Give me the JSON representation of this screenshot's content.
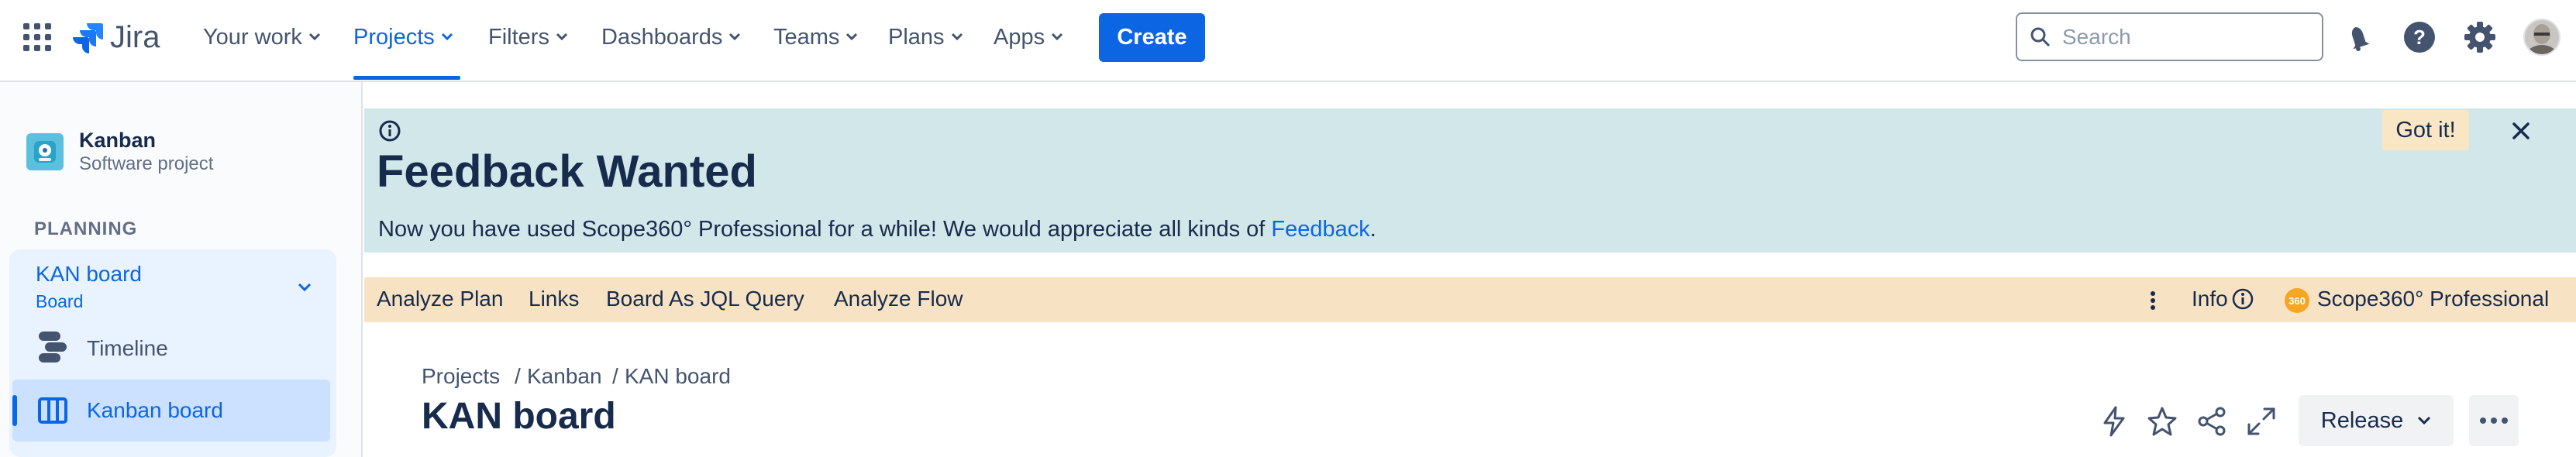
{
  "topnav": {
    "brand": "Jira",
    "items": [
      {
        "label": "Your work"
      },
      {
        "label": "Projects"
      },
      {
        "label": "Filters"
      },
      {
        "label": "Dashboards"
      },
      {
        "label": "Teams"
      },
      {
        "label": "Plans"
      },
      {
        "label": "Apps"
      }
    ],
    "create_label": "Create",
    "search_placeholder": "Search",
    "icons": [
      "app-switcher-icon",
      "notifications-icon",
      "help-icon",
      "settings-icon",
      "avatar"
    ],
    "accent_color": "#0c66e4"
  },
  "sidebar": {
    "project_name": "Kanban",
    "project_type": "Software project",
    "section_title": "PLANNING",
    "board_group_title": "KAN board",
    "board_group_subtitle": "Board",
    "items": [
      {
        "label": "Timeline",
        "icon": "timeline-icon"
      },
      {
        "label": "Kanban board",
        "icon": "board-icon",
        "selected": true
      }
    ]
  },
  "banner": {
    "title": "Feedback Wanted",
    "message": "Now you have used Scope360° Professional for a while! We would appreciate all kinds of ",
    "link": "Feedback",
    "message_end": ".",
    "got_it_label": "Got it!",
    "background": "#d2e7e9"
  },
  "scope_bar": {
    "items": [
      "Analyze Plan",
      "Links",
      "Board As JQL Query",
      "Analyze Flow"
    ],
    "info_label": "Info",
    "product_name": "Scope360° Professional",
    "product_badge": "360",
    "background": "#f8e2c4"
  },
  "header": {
    "breadcrumbs": [
      "Projects",
      "Kanban",
      "KAN board"
    ],
    "title": "KAN board",
    "release_label": "Release"
  }
}
